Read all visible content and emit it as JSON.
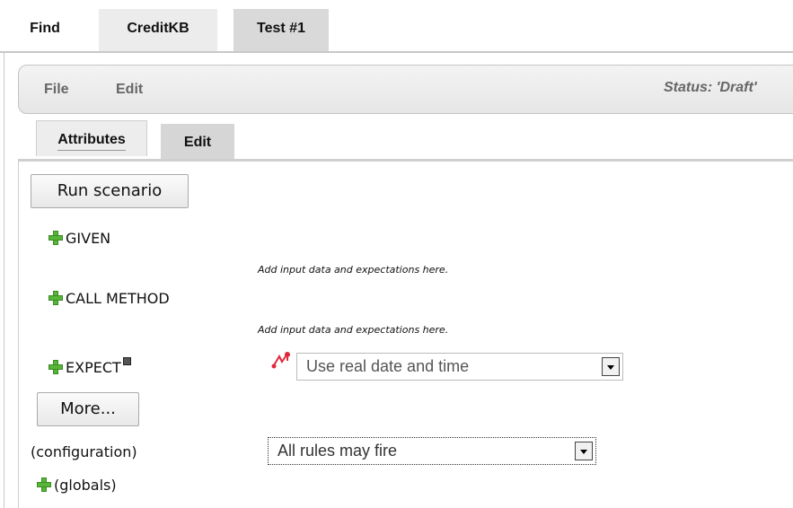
{
  "top_tabs": [
    {
      "label": "Find"
    },
    {
      "label": "CreditKB"
    },
    {
      "label": "Test #1"
    }
  ],
  "menu": {
    "file": "File",
    "edit": "Edit",
    "status": "Status: 'Draft'"
  },
  "sub_tabs": {
    "attributes": "Attributes",
    "edit": "Edit"
  },
  "buttons": {
    "run_scenario": "Run scenario",
    "more": "More..."
  },
  "sections": {
    "given": "GIVEN",
    "call_method": "CALL METHOD",
    "expect": "EXPECT",
    "configuration": "(configuration)",
    "globals": "(globals)"
  },
  "hints": {
    "given": "Add input data and expectations here.",
    "call_method": "Add input data and expectations here."
  },
  "selects": {
    "date_time": {
      "value": "Use real date and time"
    },
    "rules": {
      "value": "All rules may fire"
    }
  },
  "colors": {
    "plus_icon": "#57b537",
    "date_icon": "#e0283a"
  }
}
